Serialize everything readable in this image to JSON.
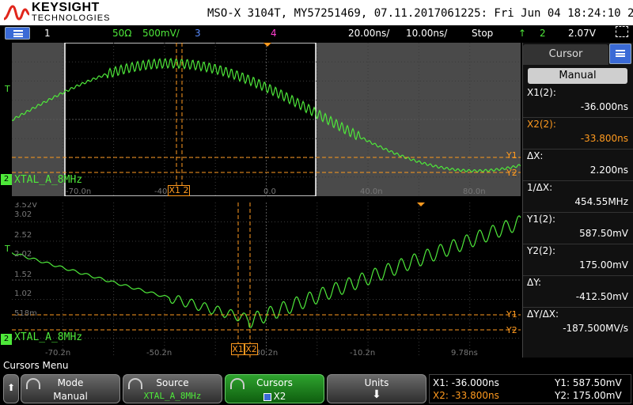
{
  "titlebar": {
    "brand": "KEYSIGHT",
    "brand_sub": "TECHNOLOGIES",
    "info": "MSO-X 3104T, MY57251469, 07.11.2017061225: Fri Jun 04 18:24:10 2021"
  },
  "statusbar": {
    "ch1": "1",
    "impedance": "50Ω",
    "vscale": "500mV/",
    "ch3": "3",
    "ch4": "4",
    "timebase": "20.00ns/",
    "delay": "10.00ns/",
    "run_state": "Stop",
    "trig_channel": "2",
    "trig_level": "2.07V"
  },
  "colors": {
    "trace": "#4ee83a",
    "cursor": "#ff9a1f",
    "accent": "#3a6ad6"
  },
  "top_panel": {
    "channel_label": "XTAL_A_8MHz",
    "ch_marker": "2",
    "time_labels": [
      "-70.0n",
      "-40.0n",
      "0.0",
      "40.0n",
      "80.0n"
    ],
    "volt_labels": [],
    "cursor_label": "X1 2",
    "y1_label": "Y1",
    "y2_label": "Y2"
  },
  "bottom_panel": {
    "channel_label": "XTAL_A_8MHz",
    "ch_marker": "2",
    "volt_labels": [
      "3.52V",
      "3.02",
      "2.52",
      "2.02",
      "1.52",
      "1.02",
      "518m"
    ],
    "time_labels": [
      "-70.2n",
      "-50.2n",
      "-30.2n",
      "-10.2n",
      "9.78ns"
    ],
    "cursor_labels": [
      "X1",
      "X2"
    ],
    "y1_label": "Y1",
    "y2_label": "Y2"
  },
  "side": {
    "title": "Cursor",
    "mode": "Manual",
    "x1_label": "X1(2):",
    "x1_value": "-36.000ns",
    "x2_label": "X2(2):",
    "x2_value": "-33.800ns",
    "dx_label": "ΔX:",
    "dx_value": "2.200ns",
    "inv_dx_label": "1/ΔX:",
    "inv_dx_value": "454.55MHz",
    "y1_label": "Y1(2):",
    "y1_value": "587.50mV",
    "y2_label": "Y2(2):",
    "y2_value": "175.00mV",
    "dy_label": "ΔY:",
    "dy_value": "-412.50mV",
    "dydx_label": "ΔY/ΔX:",
    "dydx_value": "-187.500MV/s"
  },
  "menu": {
    "title": "Cursors Menu",
    "back_symbol": "⬆",
    "mode_label": "Mode",
    "mode_value": "Manual",
    "source_label": "Source",
    "source_value": "XTAL_A_8MHz",
    "cursors_label": "Cursors",
    "cursors_value": "X2",
    "units_label": "Units",
    "units_symbol": "⬇"
  },
  "readout": {
    "x1": "X1: -36.000ns",
    "x2": "X2: -33.800ns",
    "y1": "Y1: 587.50mV",
    "y2": "Y2: 175.00mV"
  }
}
